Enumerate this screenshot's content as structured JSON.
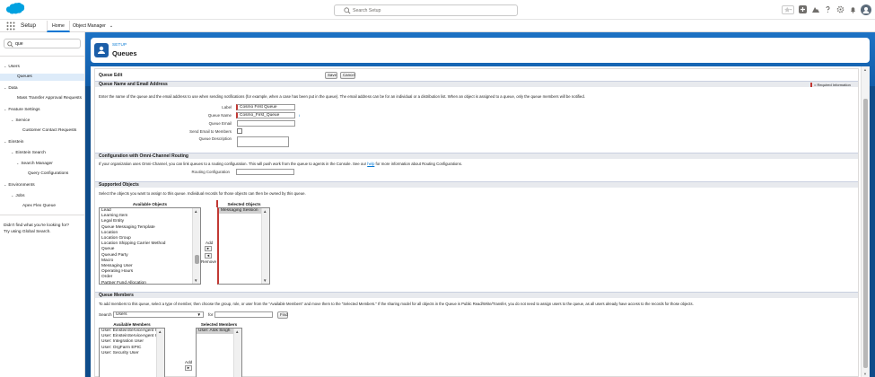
{
  "header": {
    "search_placeholder": "Search Setup",
    "app_name": "Setup",
    "tabs": [
      {
        "label": "Home"
      },
      {
        "label": "Object Manager"
      }
    ]
  },
  "sidebar": {
    "quick_find_value": "que",
    "tree": [
      {
        "label": "Users"
      },
      {
        "label": "Queues"
      },
      {
        "label": "Data"
      },
      {
        "label": "Mass Transfer Approval Requests"
      },
      {
        "label": "Feature Settings"
      },
      {
        "label": "Service"
      },
      {
        "label": "Customer Contact Requests"
      },
      {
        "label": "Einstein"
      },
      {
        "label": "Einstein Search"
      },
      {
        "label": "Search Manager"
      },
      {
        "label": "Query Configurations"
      },
      {
        "label": "Environments"
      },
      {
        "label": "Jobs"
      },
      {
        "label": "Apex Flex Queue"
      }
    ],
    "no_result_line1": "Didn't find what you're looking for?",
    "no_result_line2": "Try using Global Search."
  },
  "page": {
    "breadcrumb": "SETUP",
    "title": "Queues"
  },
  "form": {
    "title": "Queue Edit",
    "save": "Save",
    "cancel": "Cancel",
    "section_name": "Queue Name and Email Address",
    "required_info": "= Required Information",
    "instructions": "Enter the name of the queue and the email address to use when sending notifications (for example, when a case has been put in the queue). The email address can be for an individual or a distribution list. When an object is assigned to a queue, only the queue members will be notified.",
    "label_label": "Label",
    "label_value": "Cosmo First Queue",
    "qname_label": "Queue Name",
    "qname_value": "Cosmo_First_Queue",
    "info_icon": "i",
    "email_label": "Queue Email",
    "send_label": "Send Email to Members",
    "desc_label": "Queue Description",
    "section_routing": "Configuration with Omni-Channel Routing",
    "routing_text": "If your organization uses Omni-Channel, you can link queues to a routing configuration. This will push work from the queue to agents in the Console. See our",
    "routing_help": "help",
    "routing_text_end": "for more information about Routing Configurations.",
    "routing_label": "Routing Configuration",
    "section_objects": "Supported Objects",
    "objects_text": "Select the objects you want to assign to this queue. Individual records for those objects can then be owned by this queue.",
    "available_objects_label": "Available Objects",
    "selected_objects_label": "Selected Objects",
    "available_objects": [
      "Lead",
      "Learning Item",
      "Legal Entity",
      "Queue Messaging Template",
      "Location",
      "Location Group",
      "Location Shipping Carrier Method",
      "Queue",
      "Queued Party",
      "Macro",
      "Messaging User",
      "Operating Hours",
      "Order",
      "Partner Fund Allocation"
    ],
    "selected_objects": [
      "Messaging Session"
    ],
    "add_label": "Add",
    "remove_label": "Remove",
    "add_arrow": "►",
    "remove_arrow": "◄",
    "section_members": "Queue Members",
    "members_text": "To add members to this queue, select a type of member, then choose the group, role, or user from the \"Available Members\" and move them to the \"Selected Members.\" If the sharing model for all objects in the Queue is Public Read/Write/Transfer, you do not need to assign users to the queue, as all users already have access to the records for those objects.",
    "search_label": "Search",
    "search_type": "Users",
    "for_label": "for",
    "find_button": "Find",
    "available_members_label": "Available Members",
    "selected_members_label": "Selected Members",
    "available_members": [
      "User: EinsteinServiceAgent User",
      "User: EinsteinServiceAgent User",
      "User: Integration User",
      "User: OrgFarm EPIC",
      "User: Security User"
    ],
    "selected_members": [
      "User: Alok Singh"
    ],
    "members_add_label": "Add"
  },
  "colors": {
    "brand": "#0176d3",
    "header_bg": "#1b5ea8",
    "required": "#c23934"
  }
}
